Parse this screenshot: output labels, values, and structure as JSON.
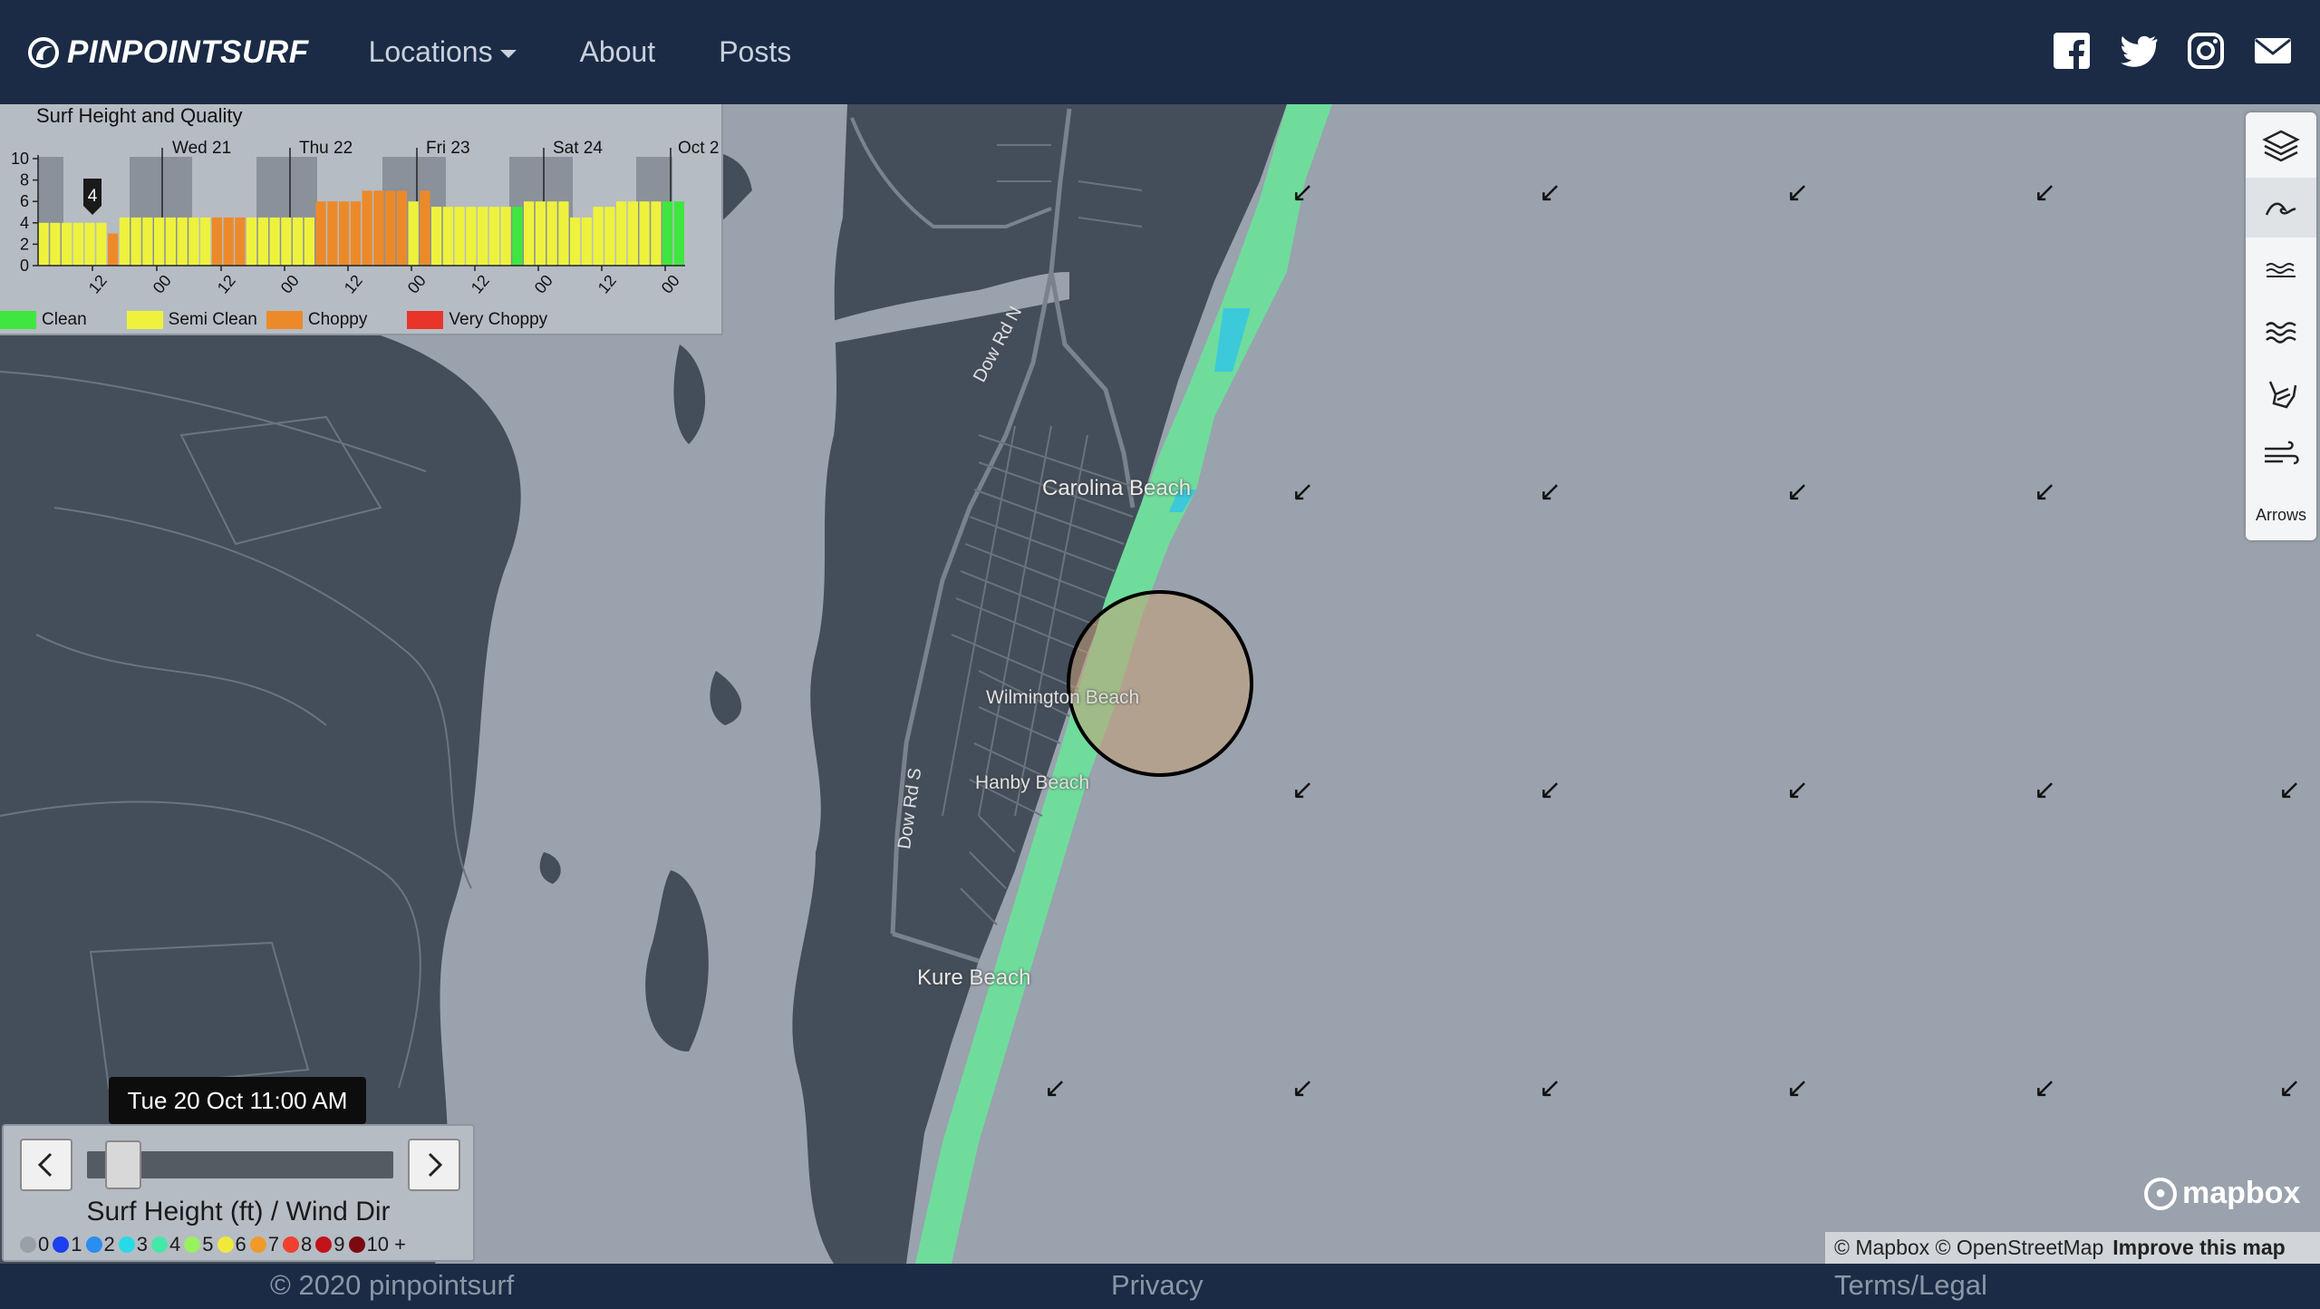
{
  "navbar": {
    "brand": "PINPOINTSURF",
    "links": [
      "Locations",
      "About",
      "Posts"
    ],
    "social_icons": [
      "facebook-icon",
      "twitter-icon",
      "instagram-icon",
      "envelope-icon"
    ]
  },
  "map": {
    "place_labels": [
      "Carolina Beach",
      "Wilmington Beach",
      "Hanby Beach",
      "Kure Beach"
    ],
    "road_labels": [
      "Dow Rd N",
      "Dow Rd S"
    ],
    "wind_arrow_glyph": "↙"
  },
  "chart_panel": {
    "title": "Surf Height and Quality",
    "marker_value": "4",
    "legend": [
      {
        "label": "Clean",
        "color": "#3fe63f"
      },
      {
        "label": "Semi Clean",
        "color": "#eef23c"
      },
      {
        "label": "Choppy",
        "color": "#ec8a2a"
      },
      {
        "label": "Very Choppy",
        "color": "#e9342a"
      }
    ]
  },
  "chart_data": {
    "type": "bar",
    "title": "Surf Height and Quality",
    "ylim": [
      0,
      10
    ],
    "y_ticks": [
      "10",
      "8",
      "6",
      "4",
      "2",
      "0"
    ],
    "day_labels": [
      "Wed 21",
      "Thu 22",
      "Fri 23",
      "Sat 24",
      "Oct 2"
    ],
    "x_tick_labels": [
      "12",
      "00",
      "12",
      "00",
      "12",
      "00",
      "12",
      "00",
      "12",
      "00"
    ],
    "values": [
      4,
      4,
      4,
      4,
      4,
      4,
      3,
      4.5,
      4.5,
      4.5,
      4.5,
      4.5,
      4.5,
      4.5,
      4.5,
      4.5,
      4.5,
      4.5,
      4.5,
      4.5,
      4.5,
      4.5,
      4.5,
      4.5,
      6,
      6,
      6,
      6,
      7,
      7,
      7,
      7,
      6,
      7,
      5.5,
      5.5,
      5.5,
      5.5,
      5.5,
      5.5,
      5.5,
      5.5,
      6,
      6,
      6,
      6,
      4.5,
      4.5,
      5.5,
      5.5,
      6,
      6,
      6,
      6,
      6,
      6
    ],
    "quality": [
      "semi",
      "semi",
      "semi",
      "semi",
      "semi",
      "semi",
      "choppy",
      "semi",
      "semi",
      "semi",
      "semi",
      "semi",
      "semi",
      "semi",
      "semi",
      "choppy",
      "choppy",
      "choppy",
      "semi",
      "semi",
      "semi",
      "semi",
      "semi",
      "semi",
      "choppy",
      "choppy",
      "choppy",
      "choppy",
      "choppy",
      "choppy",
      "choppy",
      "choppy",
      "semi",
      "choppy",
      "semi",
      "semi",
      "semi",
      "semi",
      "semi",
      "semi",
      "semi",
      "clean",
      "semi",
      "semi",
      "semi",
      "semi",
      "semi",
      "semi",
      "semi",
      "semi",
      "semi",
      "semi",
      "semi",
      "semi",
      "clean",
      "clean"
    ],
    "grid": true
  },
  "layer_control": {
    "items": [
      "layers-icon",
      "surf-icon",
      "swell-icon",
      "waves-icon",
      "shaka-icon",
      "wind-icon"
    ],
    "label": "Arrows"
  },
  "time_slider": {
    "tooltip": "Tue 20 Oct 11:00 AM",
    "title": "Surf Height (ft) / Wind Dir",
    "scale": [
      {
        "label": "0",
        "color": "#9aa0a8"
      },
      {
        "label": "1",
        "color": "#1c3ff0"
      },
      {
        "label": "2",
        "color": "#2a8ef0"
      },
      {
        "label": "3",
        "color": "#28d9e8"
      },
      {
        "label": "4",
        "color": "#45e8a8"
      },
      {
        "label": "5",
        "color": "#9af060"
      },
      {
        "label": "6",
        "color": "#f0e83a"
      },
      {
        "label": "7",
        "color": "#f09a2a"
      },
      {
        "label": "8",
        "color": "#f04030"
      },
      {
        "label": "9",
        "color": "#c0141a"
      },
      {
        "label": "10 +",
        "color": "#7a0a10"
      }
    ]
  },
  "attribution": {
    "mapbox_logo": "mapbox",
    "text": "© Mapbox © OpenStreetMap",
    "improve": "Improve this map"
  },
  "footer": {
    "copyright": "© 2020 pinpointsurf",
    "privacy": "Privacy",
    "terms": "Terms/Legal"
  }
}
